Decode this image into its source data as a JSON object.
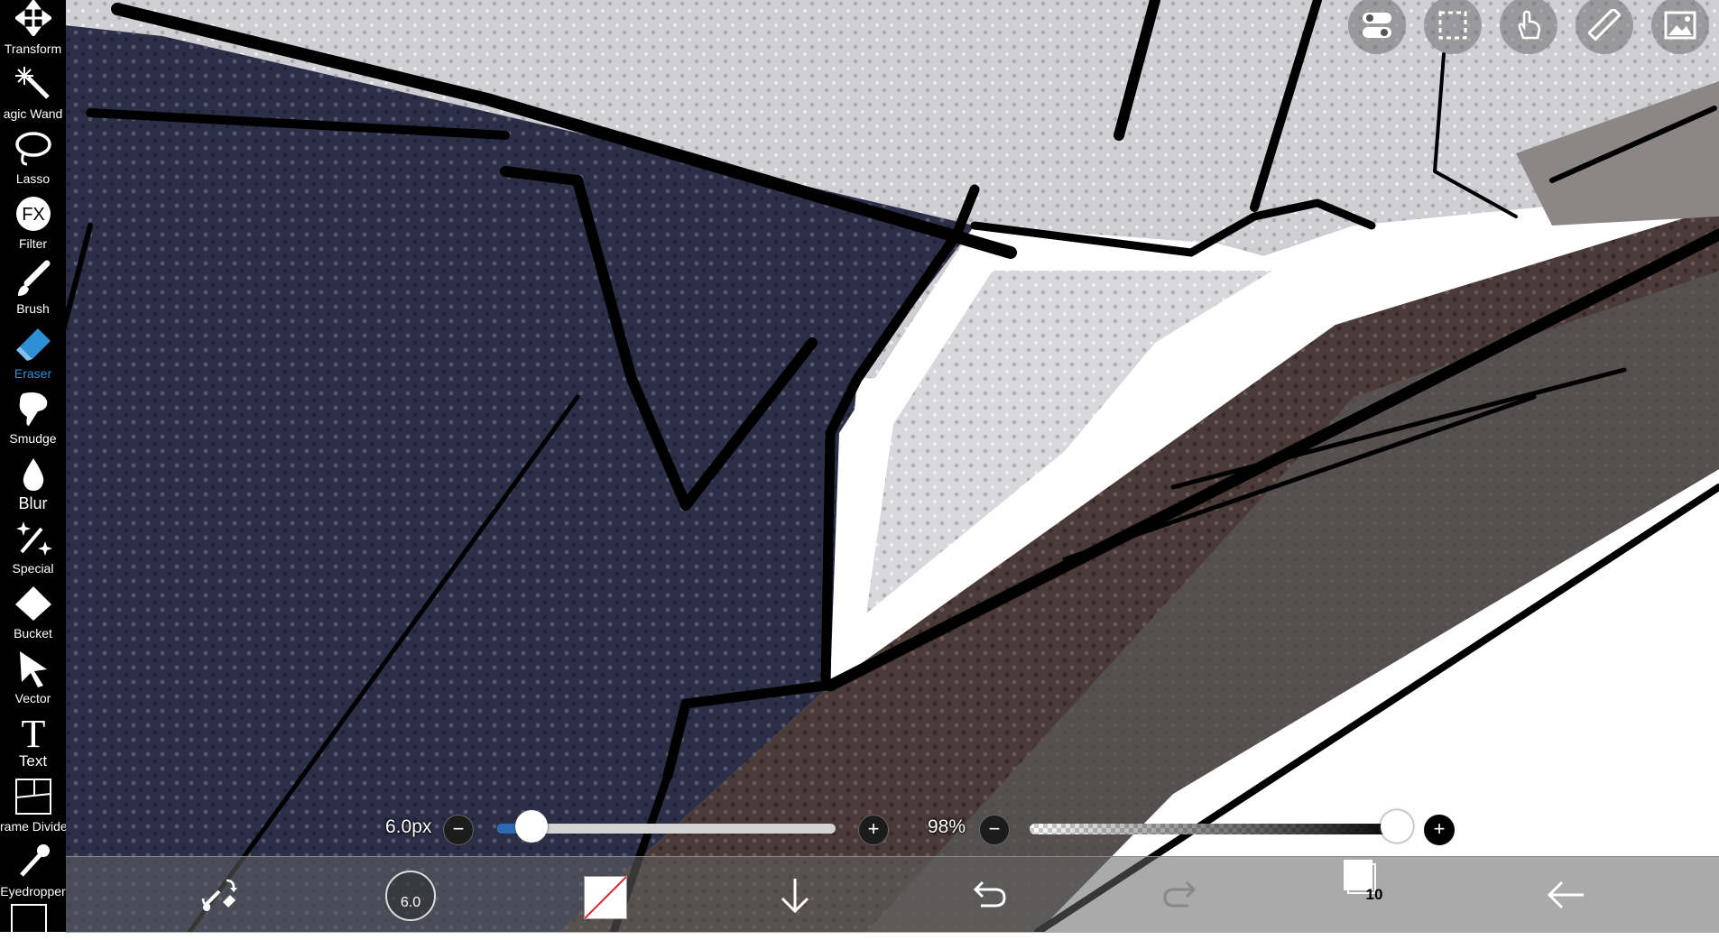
{
  "toolbar": {
    "tools": [
      {
        "label": "Transform",
        "icon": "move-arrows-icon"
      },
      {
        "label": "agic Wand",
        "icon": "magic-wand-icon"
      },
      {
        "label": "Lasso",
        "icon": "lasso-icon"
      },
      {
        "label": "Filter",
        "icon": "fx-icon"
      },
      {
        "label": "Brush",
        "icon": "brush-icon"
      },
      {
        "label": "Eraser",
        "icon": "eraser-icon"
      },
      {
        "label": "Smudge",
        "icon": "smudge-icon"
      },
      {
        "label": "Blur",
        "icon": "blur-drop-icon"
      },
      {
        "label": "Special",
        "icon": "sparkle-icon"
      },
      {
        "label": "Bucket",
        "icon": "bucket-icon"
      },
      {
        "label": "Vector",
        "icon": "pointer-arrow-icon"
      },
      {
        "label": "Text",
        "icon": "text-t-icon"
      },
      {
        "label": "rame Divider",
        "icon": "frame-divider-icon"
      },
      {
        "label": "Eyedropper",
        "icon": "eyedropper-icon"
      }
    ],
    "active_tool": "Eraser",
    "active_color": "#2d8fd6"
  },
  "top_buttons": [
    "toggle-icon",
    "selection-icon",
    "hand-icon",
    "ruler-icon",
    "image-icon"
  ],
  "brush": {
    "size_label": "6.0px",
    "size_fraction": 0.1,
    "opacity_label": "98%",
    "opacity_fraction": 0.98,
    "minus": "−",
    "plus": "+"
  },
  "bottom_bar": {
    "brush_size_preview": "6.0",
    "layer_count": "10",
    "icons": [
      "swap-tools-icon",
      "brush-size-icon",
      "color-swatch-icon",
      "download-arrow-icon",
      "undo-icon",
      "redo-icon",
      "layers-icon",
      "back-arrow-icon"
    ]
  },
  "colors": {
    "navy_fill": "#2c2f48",
    "gray_fill": "#cfcfd3",
    "brown_fill": "#4a3a38",
    "slider_fill": "#2e69b8"
  }
}
